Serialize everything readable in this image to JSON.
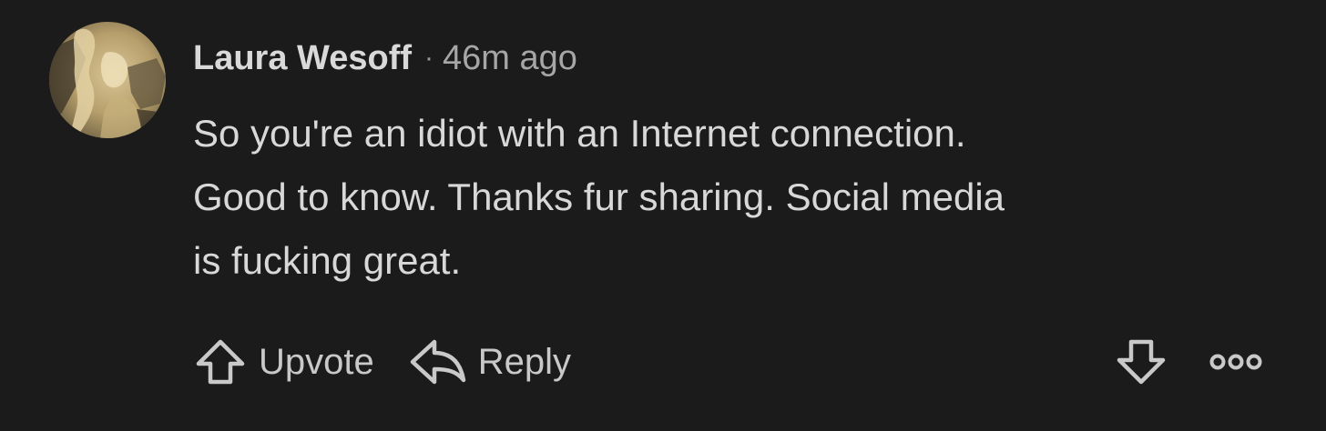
{
  "comment": {
    "author": "Laura Wesoff",
    "separator": "·",
    "timestamp": "46m ago",
    "text_lines": [
      "So you're an idiot with an Internet connection.",
      "Good to know. Thanks fur sharing. Social media",
      "is fucking great."
    ],
    "avatar_icon": "profile-photo"
  },
  "actions": {
    "upvote_label": "Upvote",
    "upvote_icon": "arrow-up-icon",
    "reply_label": "Reply",
    "reply_icon": "reply-arrow-icon",
    "downvote_icon": "arrow-down-icon",
    "more_icon": "more-options-icon"
  },
  "colors": {
    "background": "#1b1b1b",
    "text": "#d8d8d8",
    "muted": "#a6a6a6"
  }
}
